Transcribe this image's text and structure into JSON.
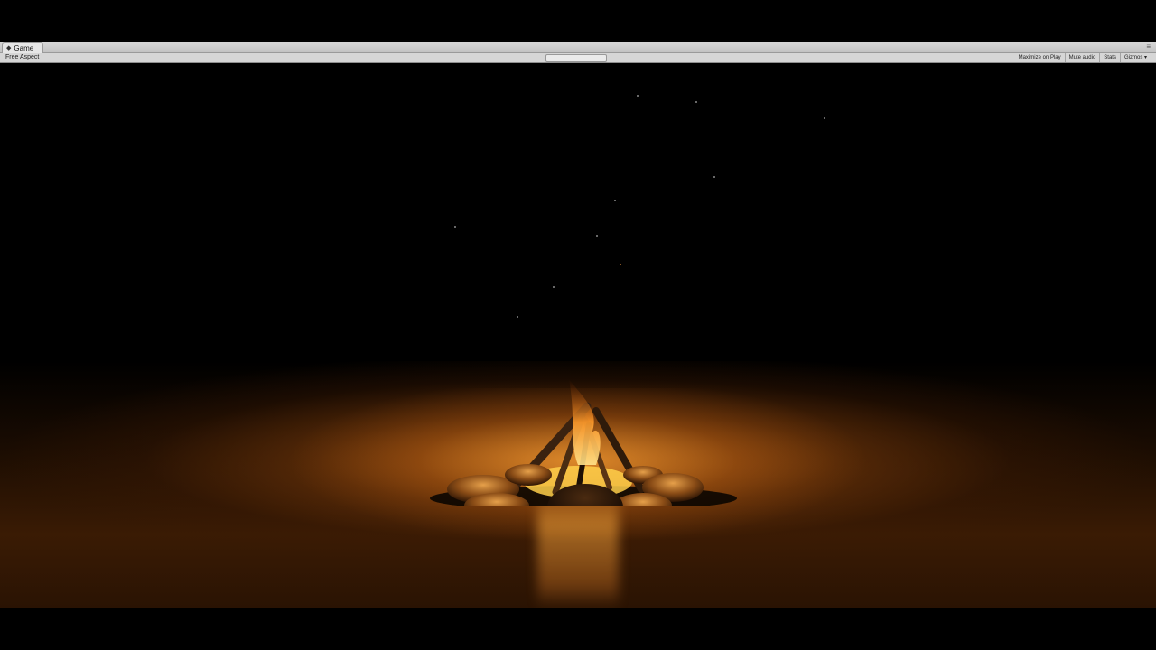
{
  "window": {
    "tab_title": "Game",
    "tab_icon": "game-controller-icon"
  },
  "toolbar": {
    "aspect_label": "Free Aspect",
    "right_buttons": [
      {
        "label": "Maximize on Play"
      },
      {
        "label": "Mute audio"
      },
      {
        "label": "Stats"
      },
      {
        "label": "Gizmos ▾"
      }
    ]
  },
  "scene": {
    "description_colors": {
      "fire_core": "#ffd36a",
      "fire_orange": "#ff9a2a",
      "floor_glow": "#cc6e18",
      "background": "#000000"
    }
  }
}
